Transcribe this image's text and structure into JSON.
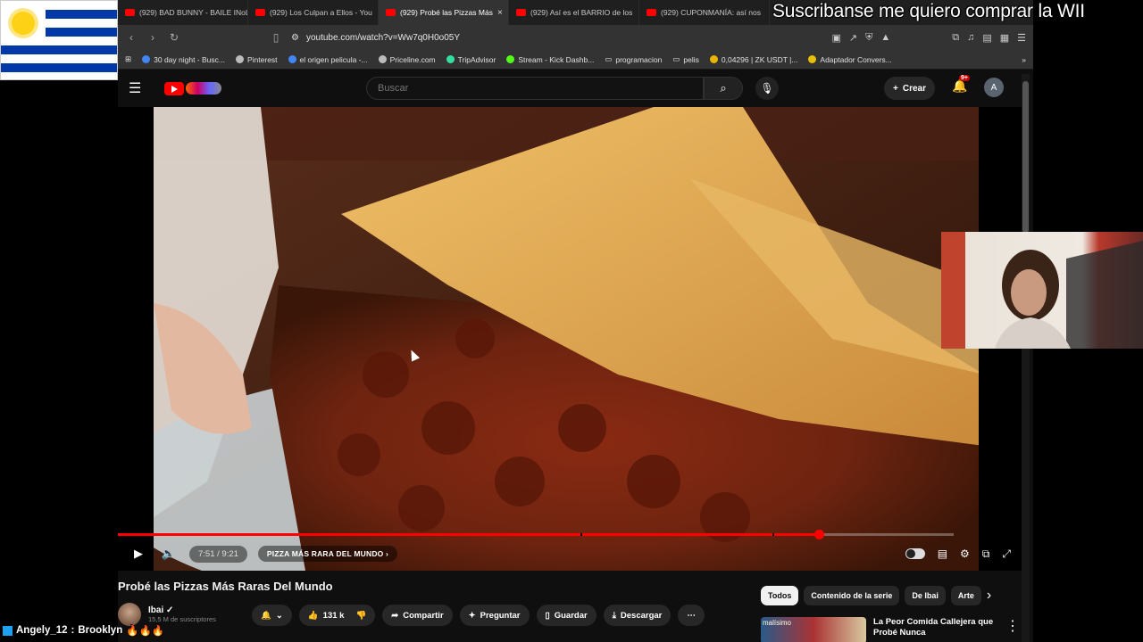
{
  "browser": {
    "tabs": [
      {
        "label": "(929) BAD BUNNY - BAILE INoLV",
        "active": false
      },
      {
        "label": "(929) Los Culpan a Ellos - You",
        "active": false
      },
      {
        "label": "(929) Probé las Pizzas Más",
        "active": true
      },
      {
        "label": "(929) Así es el BARRIO de los",
        "active": false
      },
      {
        "label": "(929) CUPONMANÍA: así nos",
        "active": false
      }
    ],
    "tab_close": "×",
    "url": "youtube.com/watch?v=Ww7q0H0o05Y",
    "bookmarks": [
      "30 day night - Busc...",
      "Pinterest",
      "el origen pelicula -...",
      "Priceline.com",
      "TripAdvisor",
      "Stream - Kick Dashb...",
      "programacion",
      "pelis",
      "0,04296 | ZK USDT |...",
      "Adaptador Convers..."
    ],
    "bookmarks_more": "»"
  },
  "youtube": {
    "search_placeholder": "Buscar",
    "create_label": "Crear",
    "notifications_badge": "9+",
    "avatar_letter": "A"
  },
  "player": {
    "time": "7:51 / 9:21",
    "chapter": "PIZZA MÁS RARA DEL MUNDO",
    "progress_fraction": 0.839
  },
  "video": {
    "title": "Probé las Pizzas Más Raras Del Mundo",
    "channel": "Ibai",
    "subscribers": "15,5 M de suscriptores",
    "likes": "131 k",
    "share_label": "Compartir",
    "ask_label": "Preguntar",
    "save_label": "Guardar",
    "download_label": "Descargar"
  },
  "sidebar": {
    "chips": [
      "Todos",
      "Contenido de la serie",
      "De Ibai",
      "Arte"
    ],
    "related_title": "La Peor Comida Callejera que Probé Nunca",
    "related_thumb_text": "malísimo"
  },
  "overlays": {
    "banner_text": "Suscribanse me quiero comprar la WII",
    "chat_user": "Angely_12",
    "chat_message": "Brooklyn",
    "chat_emojis": "🔥🔥🔥"
  },
  "colors": {
    "accent": "#ff0000",
    "background": "#0f0f0f"
  }
}
